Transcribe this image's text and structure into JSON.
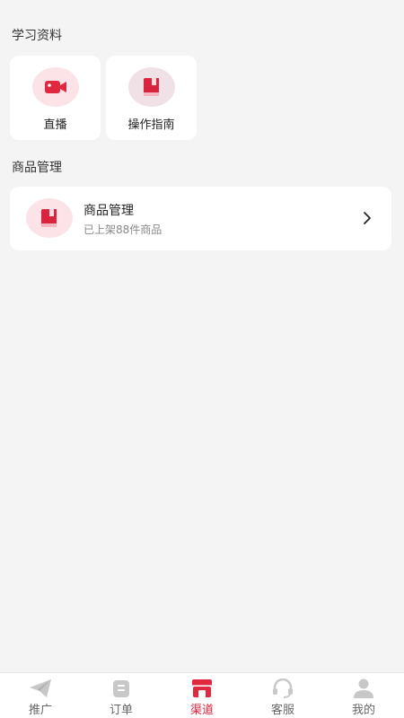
{
  "sections": {
    "learning_title": "学习资料",
    "goods_title": "商品管理"
  },
  "tiles": [
    {
      "label": "直播",
      "icon": "video-camera-icon"
    },
    {
      "label": "操作指南",
      "icon": "book-icon"
    }
  ],
  "goods_card": {
    "title": "商品管理",
    "subtitle": "已上架88件商品",
    "icon": "book-icon"
  },
  "tabbar": [
    {
      "label": "推广",
      "icon": "paper-plane-icon"
    },
    {
      "label": "订单",
      "icon": "clipboard-icon"
    },
    {
      "label": "渠道",
      "icon": "store-icon",
      "active": true
    },
    {
      "label": "客服",
      "icon": "headset-icon"
    },
    {
      "label": "我的",
      "icon": "user-icon"
    }
  ],
  "colors": {
    "accent": "#d9243e",
    "background": "#f4f4f4",
    "icon_circle": "#fbe3e7",
    "inactive_icon": "#c8c8c8"
  }
}
